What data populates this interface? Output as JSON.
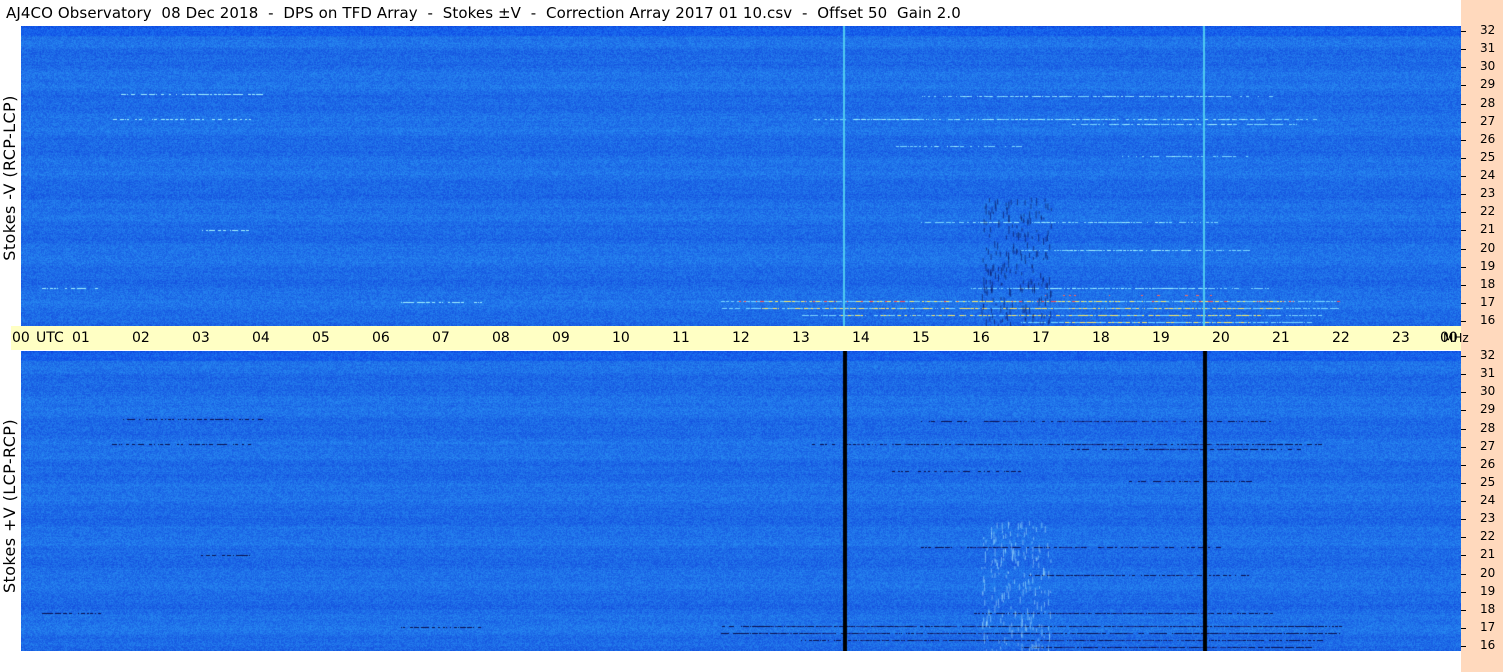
{
  "header": {
    "title": "AJ4CO Observatory  08 Dec 2018  -  DPS on TFD Array  -  Stokes ±V  -  Correction Array 2017 01 10.csv  -  Offset 50  Gain 2.0"
  },
  "panels": {
    "top_ylabel": "Stokes -V (RCP-LCP)",
    "bottom_ylabel": "Stokes +V (LCP-RCP)"
  },
  "time_axis": {
    "labels": [
      "00",
      "01",
      "02",
      "03",
      "04",
      "05",
      "06",
      "07",
      "08",
      "09",
      "10",
      "11",
      "12",
      "13",
      "14",
      "15",
      "16",
      "17",
      "18",
      "19",
      "20",
      "21",
      "22",
      "23",
      "00"
    ],
    "utc_label": "UTC",
    "unit": "MHz"
  },
  "chart_data": {
    "type": "heatmap",
    "title": "AJ4CO Observatory  08 Dec 2018  -  DPS on TFD Array  -  Stokes ±V  -  Correction Array 2017 01 10.csv  -  Offset 50  Gain 2.0",
    "xlabel": "UTC",
    "ylabel": "MHz",
    "x_range": [
      0,
      24
    ],
    "y_range": [
      16,
      32
    ],
    "y_ticks": [
      "32",
      "31",
      "30",
      "29",
      "28",
      "27",
      "26",
      "25",
      "24",
      "23",
      "22",
      "21",
      "20",
      "19",
      "18",
      "17",
      "16"
    ],
    "panels": [
      {
        "name": "Stokes -V (RCP-LCP)",
        "interference_lines_utc": [
          13.7,
          19.7
        ]
      },
      {
        "name": "Stokes +V (LCP-RCP)",
        "interference_lines_utc": [
          13.7,
          19.7
        ]
      }
    ],
    "colors": {
      "background": "#1e6ae8",
      "quiet": "#2878f0",
      "bright": "#9ff0ff",
      "hot": "#ffee66",
      "dark": "#0a1050",
      "axis_bg": "#ffffc4",
      "side_bg": "#ffd9bd"
    }
  }
}
